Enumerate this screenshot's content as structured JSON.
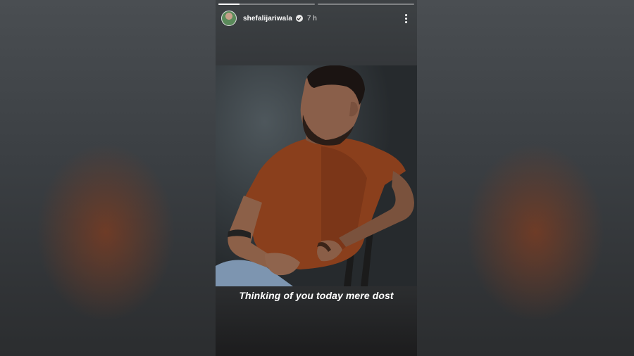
{
  "story": {
    "username": "shefalijariwala",
    "verified": true,
    "time_ago": "7 h",
    "caption": "Thinking of you today mere dost",
    "progress": [
      {
        "segment": 1,
        "fraction_complete": 0.22
      },
      {
        "segment": 2,
        "fraction_complete": 0.0
      }
    ]
  },
  "icons": {
    "more": "more-vertical-icon",
    "verified": "verified-badge-icon",
    "avatar": "profile-avatar"
  },
  "colors": {
    "accent_text": "#ffffff",
    "shirt": "#8a3f1c",
    "background": "#35383b"
  }
}
